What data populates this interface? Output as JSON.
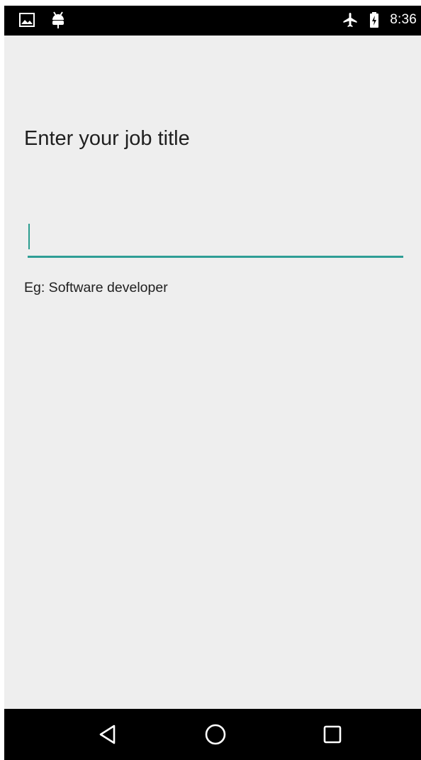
{
  "status_bar": {
    "time": "8:36",
    "icons": [
      "image-notification-icon",
      "android-notification-icon",
      "airplane-mode-icon",
      "battery-charging-icon"
    ]
  },
  "main": {
    "title": "Enter your job title",
    "input": {
      "value": "",
      "placeholder": ""
    },
    "hint": "Eg: Software developer"
  },
  "nav_bar": {
    "buttons": [
      "back-button",
      "home-button",
      "recents-button"
    ]
  },
  "colors": {
    "accent": "#2e9e95",
    "background": "#eeeeee",
    "bars": "#000000",
    "text": "#1f1f1f"
  }
}
